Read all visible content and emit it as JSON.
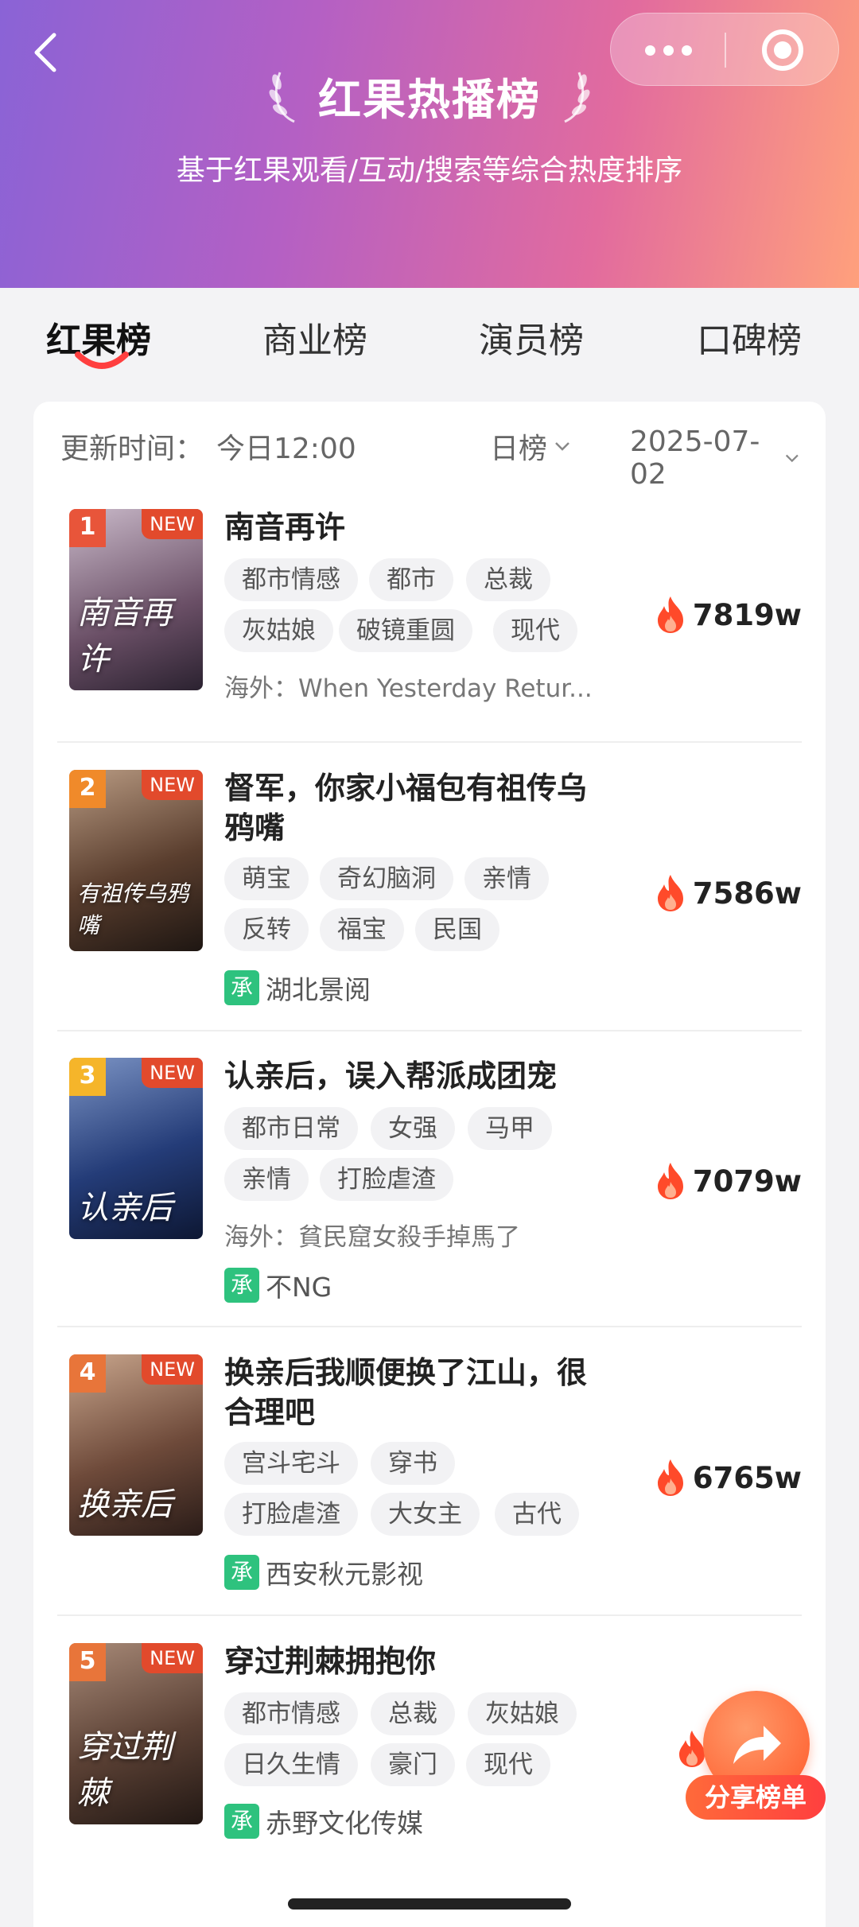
{
  "header": {
    "title": "红果热播榜",
    "subtitle": "基于红果观看/互动/搜索等综合热度排序"
  },
  "tabs": [
    {
      "label": "红果榜",
      "active": true
    },
    {
      "label": "商业榜",
      "active": false
    },
    {
      "label": "演员榜",
      "active": false
    },
    {
      "label": "口碑榜",
      "active": false
    }
  ],
  "filter": {
    "update_label": "更新时间：",
    "update_time": "今日12:00",
    "period": "日榜",
    "date": "2025-07-02"
  },
  "colors": {
    "accent": "#ff3f3f",
    "rank1": "#e8553a",
    "rank2": "#f08a2a",
    "rank3": "#f5b52a",
    "rank_other": "#e8753a",
    "producer_badge": "#2ec27e"
  },
  "items": [
    {
      "rank": "1",
      "new_badge": "NEW",
      "title": "南音再许",
      "poster_text": "南音再许",
      "tags": [
        "都市情感",
        "都市",
        "总裁",
        "灰姑娘",
        "破镜重圆",
        "现代"
      ],
      "overseas": "海外：When Yesterday Retur...",
      "producer": "",
      "heat": "7819w"
    },
    {
      "rank": "2",
      "new_badge": "NEW",
      "title": "督军，你家小福包有祖传乌鸦嘴",
      "poster_text": "有祖传乌鸦嘴",
      "tags": [
        "萌宝",
        "奇幻脑洞",
        "亲情",
        "反转",
        "福宝",
        "民国"
      ],
      "overseas": "",
      "producer_badge": "承",
      "producer": "湖北景阅",
      "heat": "7586w"
    },
    {
      "rank": "3",
      "new_badge": "NEW",
      "title": "认亲后，误入帮派成团宠",
      "poster_text": "认亲后",
      "tags": [
        "都市日常",
        "女强",
        "马甲",
        "亲情",
        "打脸虐渣"
      ],
      "overseas": "海外：貧民窟女殺手掉馬了",
      "producer_badge": "承",
      "producer": "不NG",
      "heat": "7079w"
    },
    {
      "rank": "4",
      "new_badge": "NEW",
      "title": "换亲后我顺便换了江山，很合理吧",
      "poster_text": "换亲后",
      "tags": [
        "宫斗宅斗",
        "穿书",
        "打脸虐渣",
        "大女主",
        "古代"
      ],
      "overseas": "",
      "producer_badge": "承",
      "producer": "西安秋元影视",
      "heat": "6765w"
    },
    {
      "rank": "5",
      "new_badge": "NEW",
      "title": "穿过荆棘拥抱你",
      "poster_text": "穿过荆棘",
      "tags": [
        "都市情感",
        "总裁",
        "灰姑娘",
        "日久生情",
        "豪门",
        "现代"
      ],
      "overseas": "",
      "producer_badge": "承",
      "producer": "赤野文化传媒",
      "heat": ""
    }
  ],
  "share": {
    "label": "分享榜单"
  }
}
